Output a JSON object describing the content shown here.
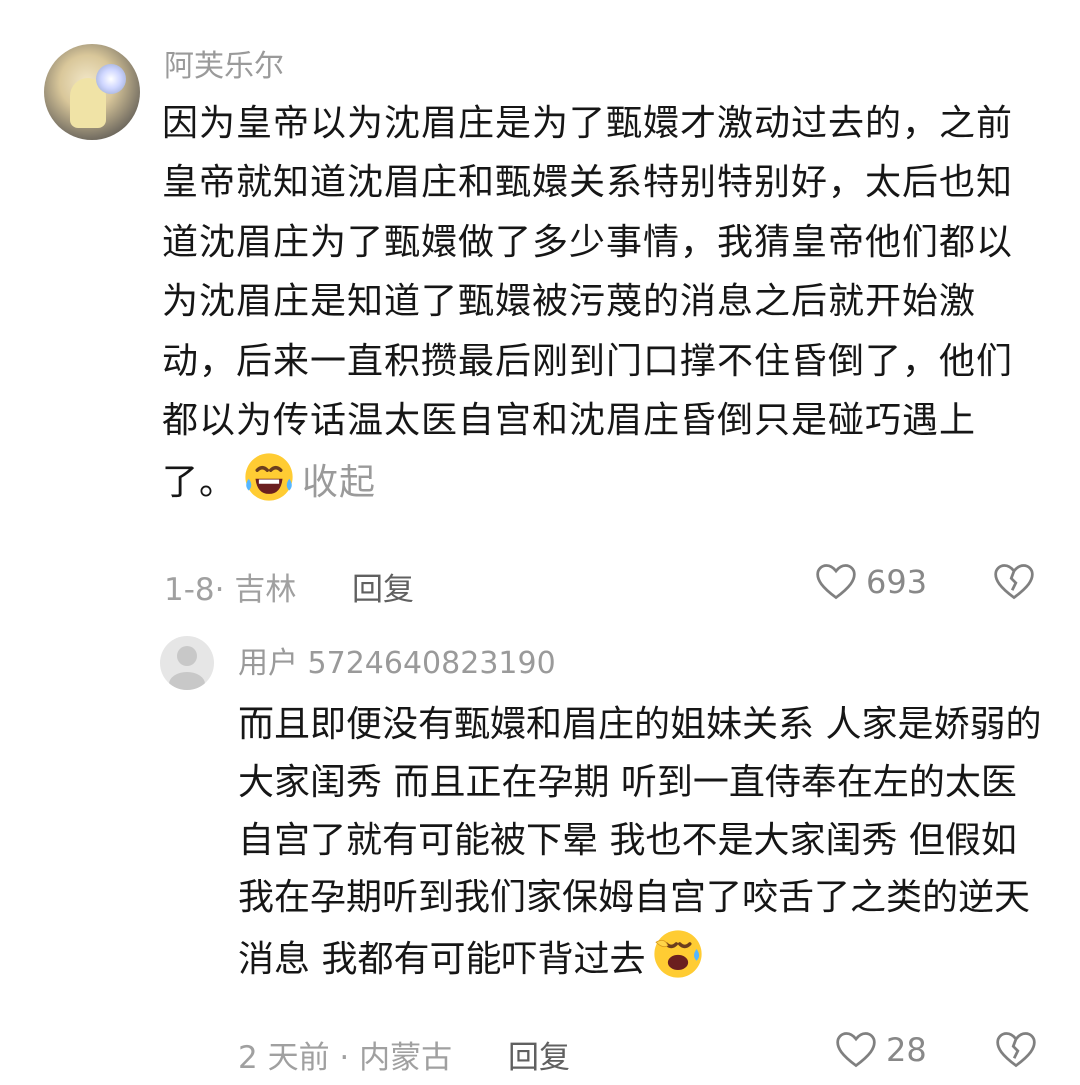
{
  "comment": {
    "username": "阿芙乐尔",
    "text": "因为皇帝以为沈眉庄是为了甄嬛才激动过去的，之前皇帝就知道沈眉庄和甄嬛关系特别特别好，太后也知道沈眉庄为了甄嬛做了多少事情，我猜皇帝他们都以为沈眉庄是知道了甄嬛被污蔑的消息之后就开始激动，后来一直积攒最后刚到门口撑不住昏倒了，他们都以为传话温太医自宫和沈眉庄昏倒只是碰巧遇上了。",
    "emoji": "sweat-laugh-emoji",
    "collapse_label": "收起",
    "date_location": "1-8· 吉林",
    "reply_label": "回复",
    "like_count": "693"
  },
  "reply": {
    "username": "用户 5724640823190",
    "text": "而且即便没有甄嬛和眉庄的姐妹关系 人家是娇弱的大家闺秀 而且正在孕期 听到一直侍奉在左的太医自宫了就有可能被下晕 我也不是大家闺秀 但假如我在孕期听到我们家保姆自宫了咬舌了之类的逆天消息 我都有可能吓背过去",
    "emoji": "rolling-laugh-emoji",
    "date_location": "2 天前 · 内蒙古",
    "reply_label": "回复",
    "like_count": "28"
  },
  "colors": {
    "meta": "#a0a0a0",
    "text": "#161616",
    "emoji_yellow": "#ffcc33"
  }
}
